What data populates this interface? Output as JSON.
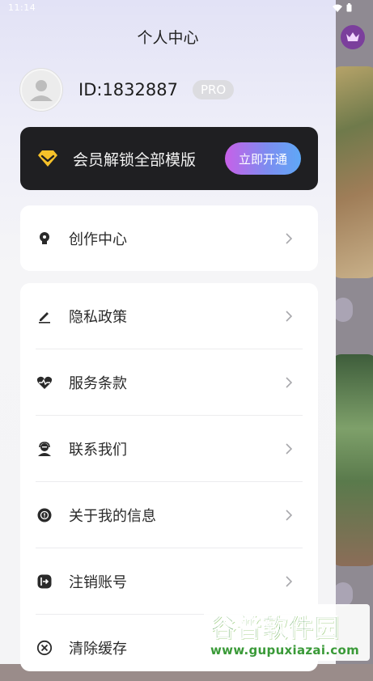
{
  "status_bar": {
    "time": "11:14"
  },
  "header": {
    "title": "个人中心"
  },
  "profile": {
    "user_id": "ID:1832887",
    "badge": "PRO"
  },
  "vip": {
    "text": "会员解锁全部模版",
    "button": "立即开通"
  },
  "menu_single": [
    {
      "icon": "lightbulb-icon",
      "label": "创作中心"
    }
  ],
  "menu_group": [
    {
      "icon": "pencil-icon",
      "label": "隐私政策"
    },
    {
      "icon": "heart-pulse-icon",
      "label": "服务条款"
    },
    {
      "icon": "support-agent-icon",
      "label": "联系我们"
    },
    {
      "icon": "info-icon",
      "label": "关于我的信息"
    },
    {
      "icon": "logout-icon",
      "label": "注销账号"
    },
    {
      "icon": "clear-cache-icon",
      "label": "清除缓存"
    }
  ],
  "watermark": {
    "brand": "谷普软件园",
    "url": "www.gupuxiazai.com"
  },
  "colors": {
    "vip_banner_bg": "#1f1f22",
    "vip_button_gradient": [
      "#c860e8",
      "#5fa8f6"
    ],
    "accent_gold": "#f6c12a",
    "crown_bg": "#7b3f9c"
  }
}
